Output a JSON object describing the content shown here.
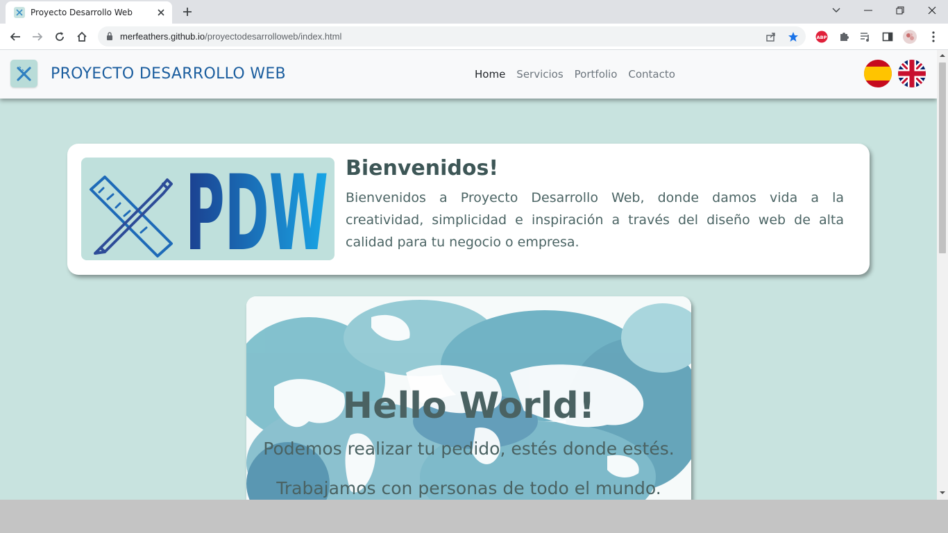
{
  "browser": {
    "tab_title": "Proyecto Desarrollo Web",
    "url_host": "merfeathers.github.io",
    "url_path": "/proyectodesarrolloweb/index.html",
    "extension_abp": "ABP"
  },
  "site": {
    "brand": "PROYECTO DESARROLLO WEB",
    "nav": [
      {
        "label": "Home"
      },
      {
        "label": "Servicios"
      },
      {
        "label": "Portfolio"
      },
      {
        "label": "Contacto"
      }
    ],
    "logo_text": "PDW"
  },
  "welcome": {
    "title": "Bienvenidos!",
    "text": "Bienvenidos a Proyecto Desarrollo Web, donde damos vida a la creatividad, simplicidad e inspiración a través del diseño web de alta calidad para tu negocio o empresa."
  },
  "hello": {
    "title": "Hello World!",
    "line1": "Podemos realizar tu pedido, estés donde estés.",
    "line2": "Trabajamos con personas de todo el mundo."
  },
  "colors": {
    "page_bg": "#c8e3df",
    "brand": "#1a5d9e",
    "heading": "#3d5656"
  }
}
